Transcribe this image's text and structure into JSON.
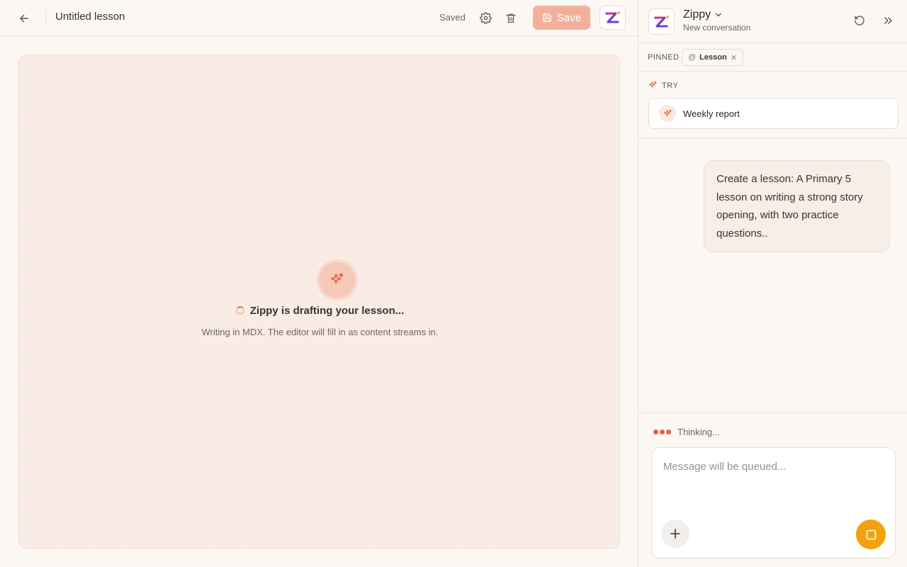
{
  "editor": {
    "title": "Untitled lesson",
    "status": "Saved",
    "save_label": "Save",
    "drafting_title": "Zippy is drafting your lesson...",
    "drafting_subtitle": "Writing in MDX. The editor will fill in as content streams in."
  },
  "panel": {
    "assistant_name": "Zippy",
    "conversation": "New conversation",
    "pinned_label": "PINNED",
    "pinned_chip": "Lesson",
    "try_label": "TRY",
    "suggestion": "Weekly report",
    "user_message": "Create a lesson: A Primary 5 lesson on writing a strong story opening, with two practice questions..",
    "thinking": "Thinking...",
    "input_placeholder": "Message will be queued..."
  },
  "colors": {
    "accent": "#e0643c",
    "save_button": "#f2b09a",
    "stop_button": "#f2a20c",
    "background": "#fbf7f3"
  },
  "icons": [
    "back-arrow-icon",
    "gear-icon",
    "trash-icon",
    "save-icon",
    "zippy-logo-icon",
    "chevron-down-icon",
    "history-icon",
    "double-chevron-right-icon",
    "sparkle-icon",
    "plus-icon",
    "stop-icon"
  ]
}
